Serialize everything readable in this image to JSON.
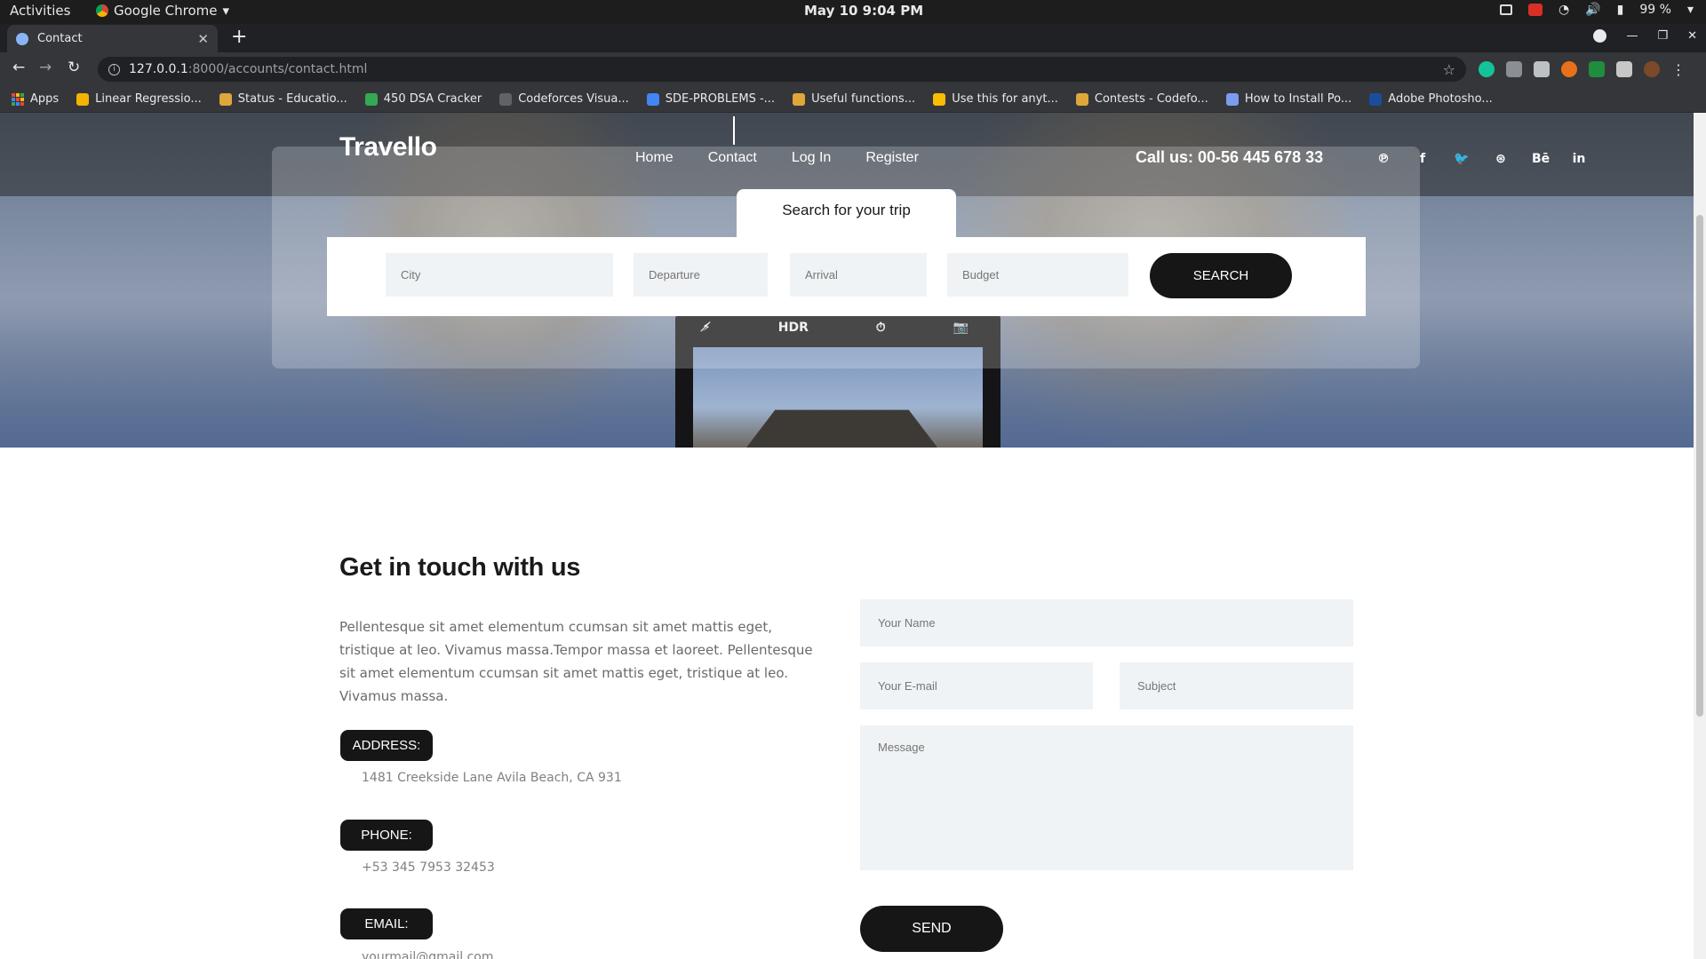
{
  "system_bar": {
    "activities": "Activities",
    "app_name": "Google Chrome",
    "clock": "May 10  9:04 PM",
    "battery": "99 %"
  },
  "browser": {
    "tab_title": "Contact",
    "url_host": "127.0.0.1",
    "url_path": ":8000/accounts/contact.html",
    "bookmarks": [
      {
        "label": "Apps",
        "icon": "apps-grid-icon",
        "color": "#8ab4f8"
      },
      {
        "label": "Linear Regressio...",
        "icon": "emoji-icon",
        "color": "#f4b400"
      },
      {
        "label": "Status - Educatio...",
        "icon": "bar-chart-icon",
        "color": "#e0a63a"
      },
      {
        "label": "450 DSA Cracker",
        "icon": "number-four-icon",
        "color": "#34a853"
      },
      {
        "label": "Codeforces Visua...",
        "icon": "cfv-icon",
        "color": "#5f6368"
      },
      {
        "label": "SDE-PROBLEMS -...",
        "icon": "doc-icon",
        "color": "#4285f4"
      },
      {
        "label": "Useful functions...",
        "icon": "bar-chart-icon",
        "color": "#e0a63a"
      },
      {
        "label": "Use this for anyt...",
        "icon": "bulb-icon",
        "color": "#fbbc04"
      },
      {
        "label": "Contests - Codefo...",
        "icon": "bar-chart-icon",
        "color": "#e0a63a"
      },
      {
        "label": "How to Install Po...",
        "icon": "globe-icon",
        "color": "#7c9cf0"
      },
      {
        "label": "Adobe Photosho...",
        "icon": "photoshop-icon",
        "color": "#1b4d9e"
      }
    ]
  },
  "site": {
    "logo": "Travello",
    "nav": [
      "Home",
      "Contact",
      "Log In",
      "Register"
    ],
    "callus": "Call us: 00-56 445 678 33",
    "social": [
      {
        "glyph": "℗",
        "name": "pinterest-icon"
      },
      {
        "glyph": "f",
        "name": "facebook-icon"
      },
      {
        "glyph": "🐦",
        "name": "twitter-icon"
      },
      {
        "glyph": "⊛",
        "name": "dribbble-icon"
      },
      {
        "glyph": "Bē",
        "name": "behance-icon"
      },
      {
        "glyph": "in",
        "name": "linkedin-icon"
      }
    ],
    "search_tab": "Search for your trip",
    "search_fields": {
      "city": "City",
      "departure": "Departure",
      "arrival": "Arrival",
      "budget": "Budget"
    },
    "search_button": "search",
    "phone_controls": [
      "⚡̸",
      "HDR",
      "⏱",
      "📷"
    ]
  },
  "contact": {
    "title": "Get in touch with us",
    "description": "Pellentesque sit amet elementum ccumsan sit amet mattis eget, tristique at leo. Vivamus massa.Tempor massa et laoreet. Pellentesque sit amet elementum ccumsan sit amet mattis eget, tristique at leo. Vivamus massa.",
    "address_label": "ADDRESS:",
    "address_value": "1481 Creekside Lane Avila Beach, CA 931",
    "phone_label": "PHONE:",
    "phone_value": "+53 345 7953 32453",
    "email_label": "EMAIL:",
    "email_value": "yourmail@gmail.com",
    "form": {
      "name_placeholder": "Your Name",
      "email_placeholder": "Your E-mail",
      "subject_placeholder": "Subject",
      "message_placeholder": "Message",
      "send_label": "send"
    }
  }
}
